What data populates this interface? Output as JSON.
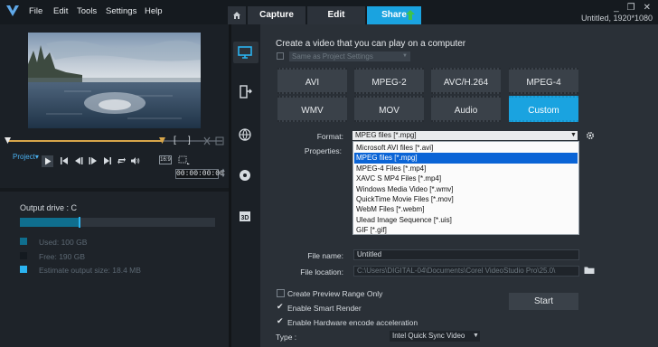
{
  "menu": {
    "file": "File",
    "edit": "Edit",
    "tools": "Tools",
    "settings": "Settings",
    "help": "Help"
  },
  "tabs": {
    "capture": "Capture",
    "edit": "Edit",
    "share": "Share"
  },
  "window": {
    "title": "Untitled, 1920*1080",
    "minimize": "_",
    "restore": "❐",
    "close": "✕"
  },
  "player": {
    "project_label": "Project▾",
    "bracket_in": "[",
    "bracket_out": "]",
    "aspect": "16:9",
    "timecode": "00:00:00:00"
  },
  "output": {
    "drive_label": "Output drive : C",
    "used": "Used:  100 GB",
    "free": "Free:  190 GB",
    "estimate": "Estimate output size:  18.4 MB",
    "used_fraction": 0.3
  },
  "share": {
    "heading": "Create a video that you can play on a computer",
    "same_as_project": "Same as Project Settings",
    "formats": [
      "AVI",
      "MPEG-2",
      "AVC/H.264",
      "MPEG-4",
      "WMV",
      "MOV",
      "Audio",
      "Custom"
    ],
    "format_label": "Format:",
    "properties_label": "Properties:",
    "format_value": "MPEG files [*.mpg]",
    "dropdown": [
      "Microsoft AVI files [*.avi]",
      "MPEG files [*.mpg]",
      "MPEG-4 Files [*.mp4]",
      "XAVC S MP4 Files [*.mp4]",
      "Windows Media Video [*.wmv]",
      "QuickTime Movie Files [*.mov]",
      "WebM Files [*.webm]",
      "Ulead Image Sequence [*.uis]",
      "GIF [*.gif]"
    ],
    "file_name_label": "File name:",
    "file_name_value": "Untitled",
    "file_location_label": "File location:",
    "file_location_value": "C:\\Users\\DIGITAL-04\\Documents\\Corel VideoStudio Pro\\25.0\\",
    "create_preview": "Create Preview Range Only",
    "smart_render": "Enable Smart Render",
    "hw_encode": "Enable Hardware encode acceleration",
    "start": "Start",
    "type_label": "Type :",
    "type_value": "Intel Quick Sync Video"
  },
  "colors": {
    "accent": "#1aa3e0",
    "selected_list": "#0a64d6",
    "timeline": "#d8a64a"
  },
  "icons": [
    "corel-logo-icon",
    "home-icon",
    "upload-arrow-icon",
    "computer-icon",
    "device-icon",
    "web-icon",
    "disc-icon",
    "3d-icon",
    "gear-icon",
    "folder-icon",
    "play-icon"
  ]
}
